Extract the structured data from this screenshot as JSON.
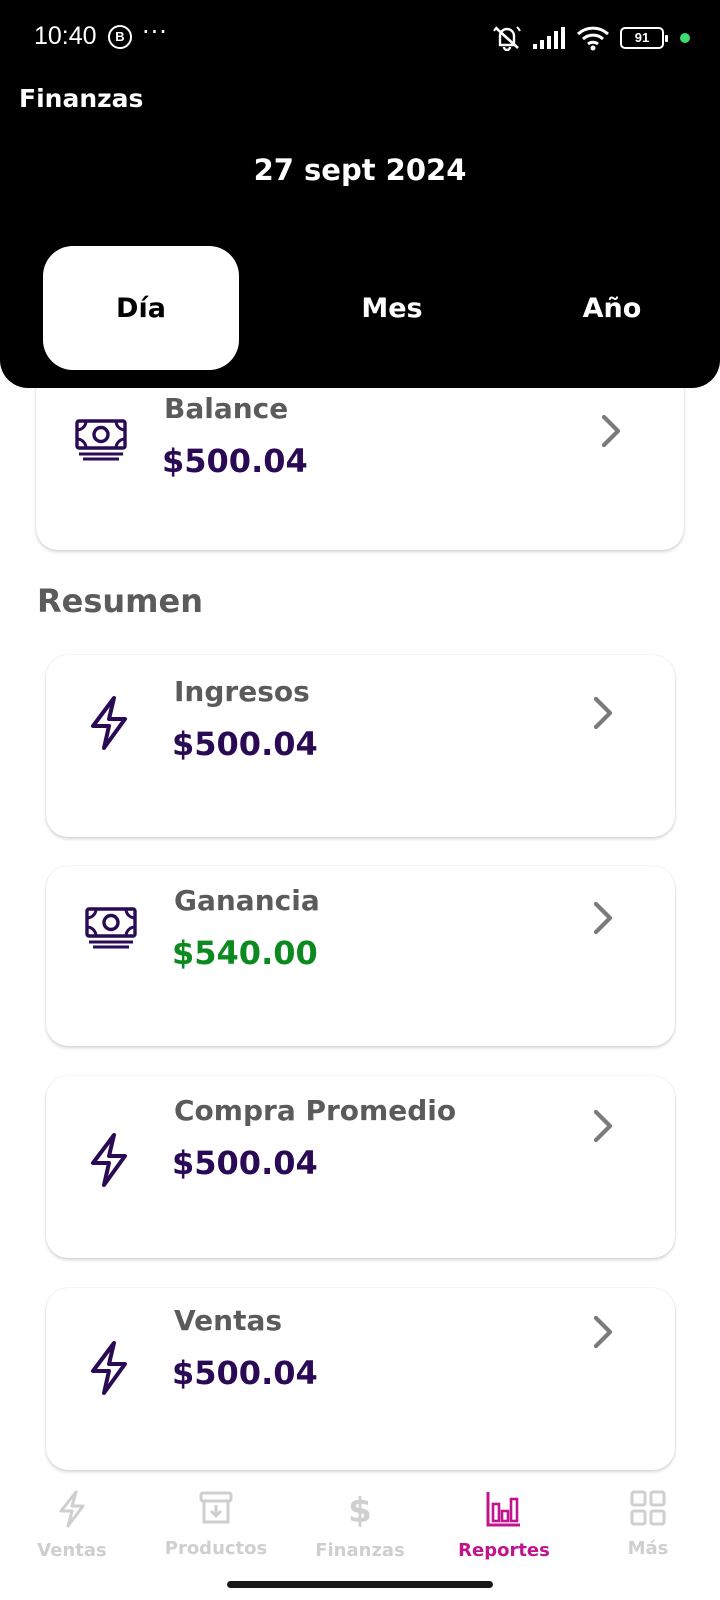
{
  "status_bar": {
    "time": "10:40",
    "b_badge": "B",
    "dots": "···",
    "battery": "91"
  },
  "header": {
    "title": "Finanzas",
    "date": "27 sept 2024",
    "tabs": [
      {
        "label": "Día",
        "active": true
      },
      {
        "label": "Mes",
        "active": false
      },
      {
        "label": "Año",
        "active": false
      }
    ]
  },
  "balance": {
    "label": "Balance",
    "value": "$500.04",
    "icon": "money-icon"
  },
  "summary": {
    "title": "Resumen",
    "items": [
      {
        "label": "Ingresos",
        "value": "$500.04",
        "icon": "lightning-icon",
        "value_color": "#2a0a55"
      },
      {
        "label": "Ganancia",
        "value": "$540.00",
        "icon": "money-icon",
        "value_color": "#0d8a1f"
      },
      {
        "label": "Compra Promedio",
        "value": "$500.04",
        "icon": "lightning-icon",
        "value_color": "#2a0a55"
      },
      {
        "label": "Ventas",
        "value": "$500.04",
        "icon": "lightning-icon",
        "value_color": "#2a0a55"
      }
    ]
  },
  "bottom_nav": {
    "items": [
      {
        "label": "Ventas",
        "icon": "lightning-icon",
        "active": false
      },
      {
        "label": "Productos",
        "icon": "archive-icon",
        "active": false
      },
      {
        "label": "Finanzas",
        "icon": "dollar-icon",
        "active": false
      },
      {
        "label": "Reportes",
        "icon": "bar-chart-icon",
        "active": true
      },
      {
        "label": "Más",
        "icon": "grid-icon",
        "active": false
      }
    ]
  },
  "colors": {
    "header_bg": "#000000",
    "accent": "#c0148f",
    "value_purple": "#2a0a55",
    "value_green": "#0d8a1f",
    "icon_purple": "#2a0a55",
    "inactive": "#cfcfcf"
  }
}
